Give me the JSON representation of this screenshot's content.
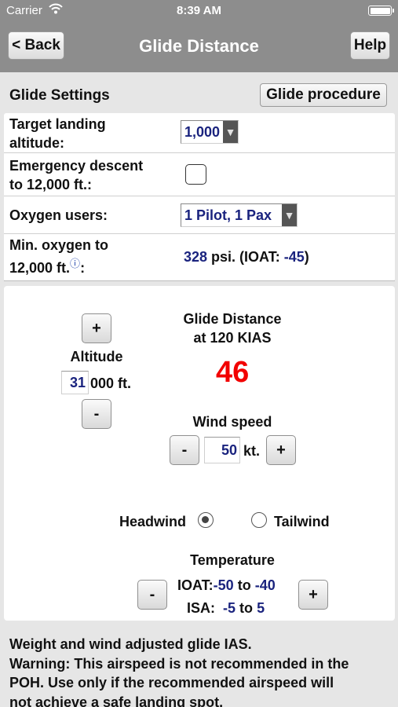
{
  "status": {
    "carrier": "Carrier",
    "time": "8:39 AM"
  },
  "nav": {
    "back": "< Back",
    "title": "Glide Distance",
    "help": "Help"
  },
  "settings": {
    "header": "Glide Settings",
    "procedure_button": "Glide procedure",
    "target_label_1": "Target landing",
    "target_label_2": "altitude:",
    "target_value": "1,000",
    "emergency_label_1": "Emergency descent",
    "emergency_label_2": "to 12,000 ft.:",
    "emergency_checked": false,
    "oxygen_label": "Oxygen users:",
    "oxygen_value": "1 Pilot, 1 Pax",
    "minox_label_1": "Min. oxygen to",
    "minox_label_2": "12,000 ft.",
    "minox_info_icon": "info-icon",
    "minox_colon": ":",
    "minox_psi": "328",
    "minox_psi_unit": " psi. (IOAT: ",
    "minox_ioat": "-45",
    "minox_close": ")"
  },
  "glide": {
    "plus": "+",
    "minus": "-",
    "altitude_label": "Altitude",
    "altitude_value": "31",
    "altitude_unit": "000 ft.",
    "distance_title_1": "Glide Distance",
    "distance_title_2": "at 120 KIAS",
    "distance_value": "46",
    "wind_label": "Wind speed",
    "wind_value": "50",
    "wind_unit": "kt.",
    "headwind": "Headwind",
    "tailwind": "Tailwind",
    "wind_direction": "Headwind",
    "temperature_label": "Temperature",
    "ioat_label": "IOAT:",
    "ioat_low": "-50",
    "ioat_to": "to",
    "ioat_high": "-40",
    "isa_label": "ISA:",
    "isa_low": "-5",
    "isa_to": "to",
    "isa_high": "5"
  },
  "footer": {
    "line1": "Weight and wind adjusted glide IAS.",
    "line2": "Warning: This airspeed is not recommended in the",
    "line3": "POH. Use only if the recommended airspeed will",
    "line4": "not achieve a safe landing spot."
  },
  "colors": {
    "accent_red": "#f20000",
    "value_blue": "#1a237e",
    "nav_gray": "#8d8d8d"
  }
}
